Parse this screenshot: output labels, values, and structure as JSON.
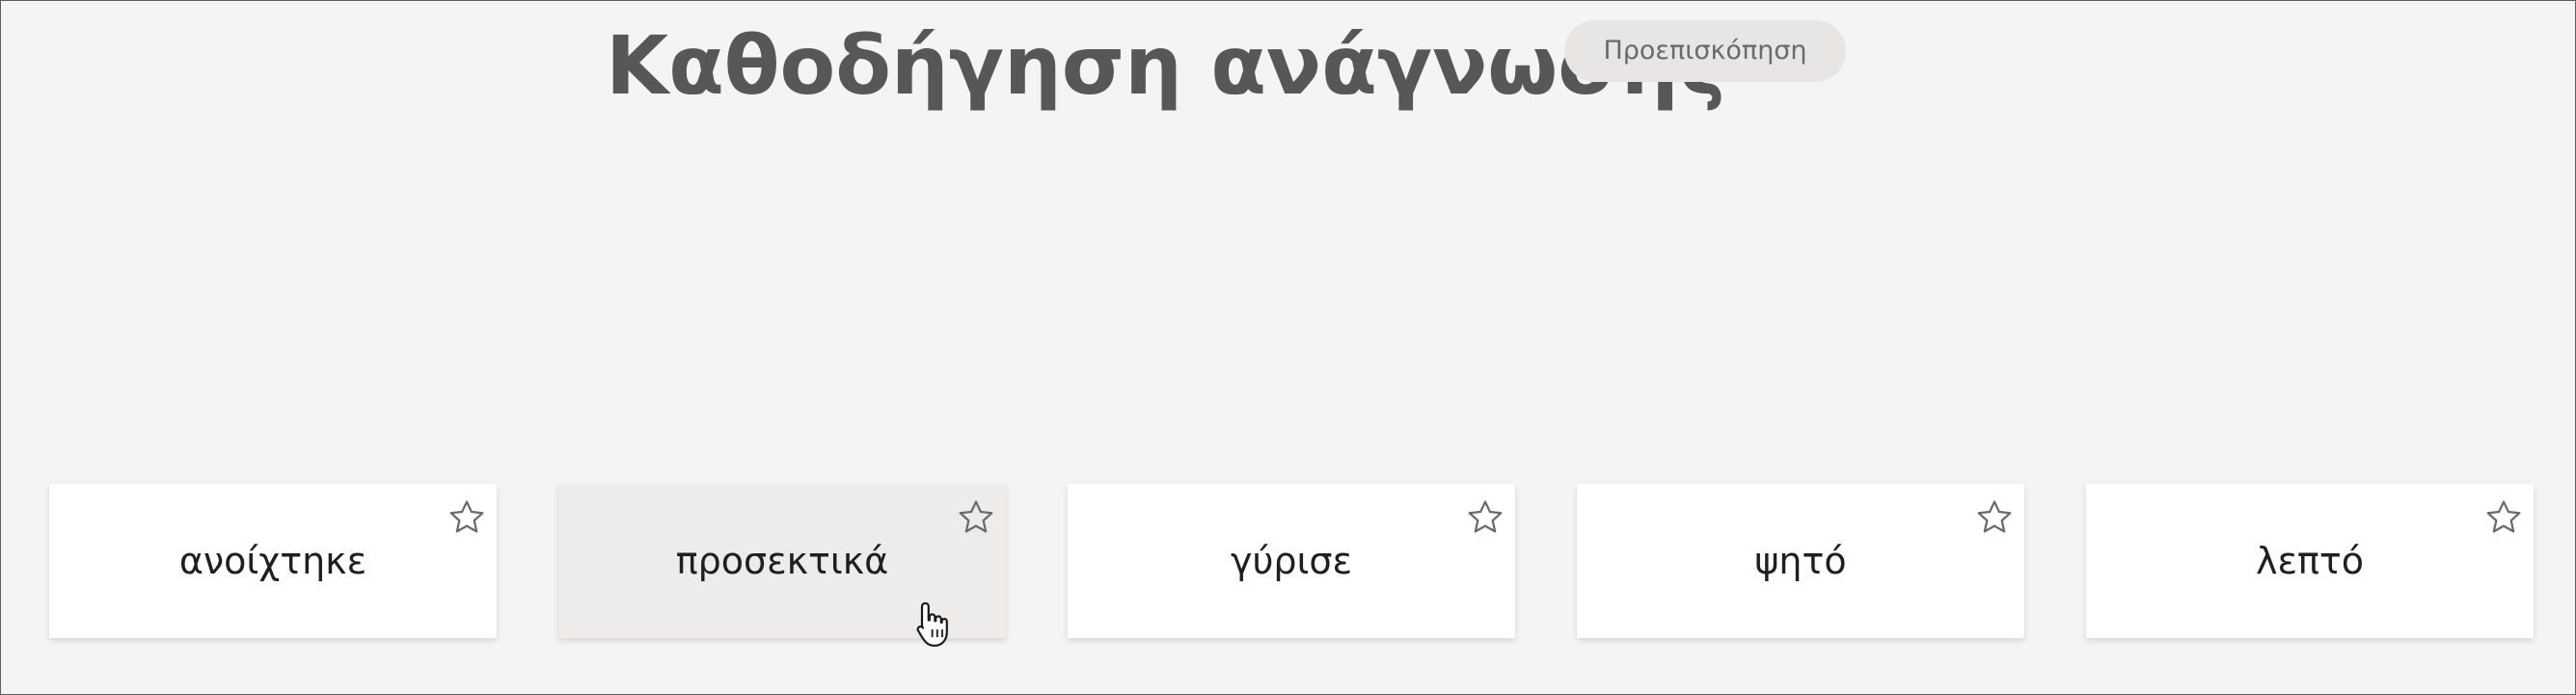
{
  "header": {
    "title": "Καθοδήγηση ανάγνωσης",
    "preview_label": "Προεπισκόπηση"
  },
  "cards": [
    {
      "word": "ανοίχτηκε",
      "hovered": false,
      "star": "star-outline-icon"
    },
    {
      "word": "προσεκτικά",
      "hovered": true,
      "star": "star-outline-icon"
    },
    {
      "word": "γύρισε",
      "hovered": false,
      "star": "star-outline-icon"
    },
    {
      "word": "ψητό",
      "hovered": false,
      "star": "star-outline-icon"
    },
    {
      "word": "λεπτό",
      "hovered": false,
      "star": "star-outline-icon"
    }
  ],
  "colors": {
    "background": "#f4f4f4",
    "title": "#575757",
    "button_bg": "#e7e6e5",
    "card_bg": "#ffffff",
    "card_hover_bg": "#edecea",
    "star_stroke": "#6b6b6b"
  },
  "cursor": "hand-pointer-icon"
}
